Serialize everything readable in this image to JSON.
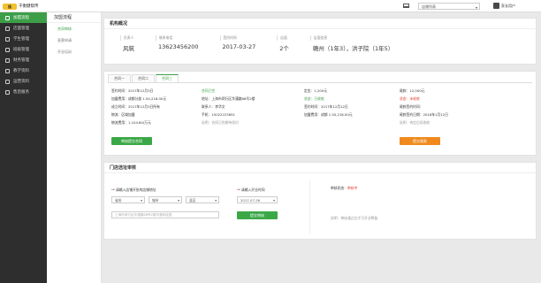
{
  "top": {
    "logo_badge": "佳",
    "logo_text": "干衡健帮传",
    "store_select": "店铺列表",
    "user_name": "家长用户"
  },
  "sidebar": {
    "items": [
      {
        "label": "加盟流程",
        "icon": "flow-icon"
      },
      {
        "label": "店面管理",
        "icon": "store-icon"
      },
      {
        "label": "学生管理",
        "icon": "student-icon"
      },
      {
        "label": "班级管理",
        "icon": "class-icon"
      },
      {
        "label": "财务管理",
        "icon": "finance-icon"
      },
      {
        "label": "教学资料",
        "icon": "book-icon"
      },
      {
        "label": "运营资料",
        "icon": "ops-icon"
      },
      {
        "label": "售后服务",
        "icon": "service-icon"
      }
    ]
  },
  "subnav": {
    "title": "加盟流程",
    "items": [
      "合同审核",
      "直营申请",
      "开业培训"
    ]
  },
  "org": {
    "title": "机构概况",
    "fields": [
      {
        "label": "负责人",
        "value": "风筑"
      },
      {
        "label": "联系电话",
        "value": "13623456200"
      },
      {
        "label": "签约时间",
        "value": "2017-03-27"
      },
      {
        "label": "店面",
        "value": "2个"
      },
      {
        "label": "店面信息",
        "value": "赣州（1年3），洪子院（1年5）"
      }
    ]
  },
  "contract": {
    "tabs": [
      "合同一",
      "合同二",
      "合同三"
    ],
    "col1": [
      "签约时间：2017年12月3日",
      "加盟费用：成都分部  1.50,218.00元",
      "成立时间：2017年12月3日所有",
      "物流：区域加盟",
      "物流费用：1,104.80/万元"
    ],
    "col1_button": "审核提交合同",
    "col2_status": "合同已完",
    "col2": [
      "地址：上海市闵行区华漕路88号2楼",
      "联系人：李华文",
      "手机：15022223651",
      "说明：合同已到期待续约"
    ],
    "col3": [
      "定金：1,200元",
      "状态：已收款",
      "签约时间：2017年12月12日",
      "加盟费用：成都  1.50,218.00元"
    ],
    "col4": [
      "尾款：12,000元",
      "状态：未收款",
      "尾款签约时间：",
      "尾款签约日期：2018年1月12日",
      "说明：待定后续收款"
    ],
    "col4_button": "提交尾款"
  },
  "approval": {
    "title": "门店选址审核",
    "address_label": "* 请输入店铺开张的店铺地址",
    "province": "省份",
    "city": "城市",
    "district": "县区",
    "address_placeholder": "上海市闵行区华漕路88号2楼华漕科技园",
    "date_label": "* 请输入开业时间",
    "date_value": "2017-07-26",
    "submit": "提交审核",
    "status_label": "审核状态：",
    "status_value": "审核中",
    "note": "说明：审核通过后才可开业筹备"
  }
}
